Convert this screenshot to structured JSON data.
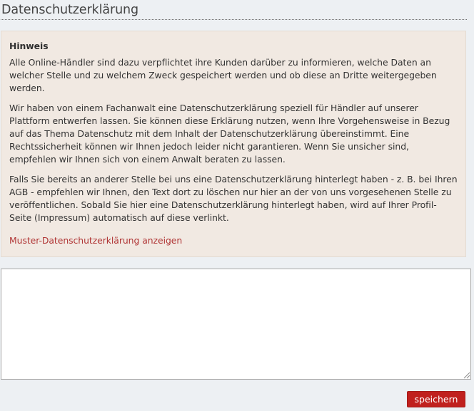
{
  "page": {
    "title": "Datenschutzerklärung"
  },
  "notice": {
    "heading": "Hinweis",
    "paragraphs": [
      "Alle Online-Händler sind dazu verpflichtet ihre Kunden darüber zu informieren, welche Daten an welcher Stelle und zu welchem Zweck gespeichert werden und ob diese an Dritte weitergegeben werden.",
      "Wir haben von einem Fachanwalt eine Datenschutzerklärung speziell für Händler auf unserer Plattform entwerfen lassen. Sie können diese Erklärung nutzen, wenn Ihre Vorgehensweise in Bezug auf das Thema Datenschutz mit dem Inhalt der Datenschutzerklärung übereinstimmt. Eine Rechtssicherheit können wir Ihnen jedoch leider nicht garantieren. Wenn Sie unsicher sind, empfehlen wir Ihnen sich von einem Anwalt beraten zu lassen.",
      "Falls Sie bereits an anderer Stelle bei uns eine Datenschutzerklärung hinterlegt haben - z. B. bei Ihren AGB - empfehlen wir Ihnen, den Text dort zu löschen nur hier an der von uns vorgesehenen Stelle zu veröffentlichen. Sobald Sie hier eine Datenschutzerklärung hinterlegt haben, wird auf Ihrer Profil-Seite (Impressum) automatisch auf diese verlinkt."
    ],
    "link_label": "Muster-Datenschutzerklärung anzeigen"
  },
  "editor": {
    "value": ""
  },
  "actions": {
    "save_label": "speichern"
  },
  "colors": {
    "background": "#edf0f3",
    "notice_background": "#f1e9e2",
    "link": "#b03535",
    "primary_button": "#c0201d"
  }
}
